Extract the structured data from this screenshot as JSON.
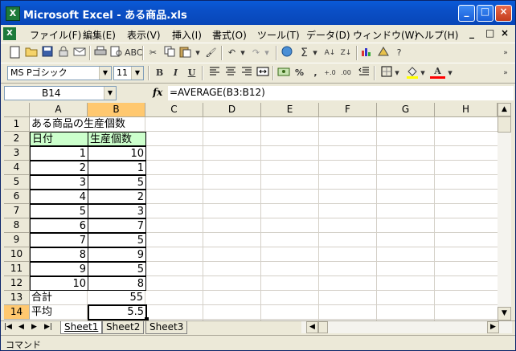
{
  "window": {
    "title": "Microsoft Excel - ある商品.xls",
    "app_icon": "excel-icon",
    "controls": {
      "minimize": "_",
      "maximize": "□",
      "close": "×"
    }
  },
  "menu": {
    "items": [
      "ファイル(F)",
      "編集(E)",
      "表示(V)",
      "挿入(I)",
      "書式(O)",
      "ツール(T)",
      "データ(D)",
      "ウィンドウ(W)",
      "ヘルプ(H)"
    ],
    "mdi": [
      "_",
      "□",
      "×"
    ]
  },
  "toolbar_standard": {
    "icons": [
      "new-icon",
      "open-icon",
      "save-icon",
      "permission-icon",
      "email-icon",
      "print-icon",
      "print-preview-icon",
      "spelling-icon",
      "cut-icon",
      "copy-icon",
      "paste-icon",
      "format-painter-icon",
      "undo-icon",
      "redo-icon",
      "hyperlink-icon",
      "autosum-icon",
      "sort-ascending-icon",
      "sort-descending-icon",
      "chart-wizard-icon",
      "drawing-icon",
      "help-icon"
    ],
    "glyphs": {
      "autosum": "Σ",
      "sort_asc": "A↓",
      "sort_desc": "Z↓"
    }
  },
  "toolbar_formatting": {
    "font_name": "MS Pゴシック",
    "font_size": "11",
    "bold": "B",
    "italic": "I",
    "underline": "U",
    "percent": "%",
    "comma": ",",
    "increase_decimal": "+.0",
    "decrease_decimal": ".00",
    "font_color_glyph": "A"
  },
  "formula_bar": {
    "name_box": "B14",
    "fx": "fx",
    "formula": "=AVERAGE(B3:B12)"
  },
  "columns": [
    "A",
    "B",
    "C",
    "D",
    "E",
    "F",
    "G",
    "H"
  ],
  "rows": [
    "1",
    "2",
    "3",
    "4",
    "5",
    "6",
    "7",
    "8",
    "9",
    "10",
    "11",
    "12",
    "13",
    "14"
  ],
  "sheet": {
    "title": "ある商品の生産個数",
    "header_date": "日付",
    "header_qty": "生産個数",
    "dates": [
      "1",
      "2",
      "3",
      "4",
      "5",
      "6",
      "7",
      "8",
      "9",
      "10"
    ],
    "quantities": [
      "10",
      "1",
      "5",
      "2",
      "3",
      "7",
      "5",
      "9",
      "5",
      "8"
    ],
    "total_label": "合計",
    "total_value": "55",
    "avg_label": "平均",
    "avg_value": "5.5"
  },
  "tabs": [
    "Sheet1",
    "Sheet2",
    "Sheet3"
  ],
  "tab_nav": [
    "|◀",
    "◀",
    "▶",
    "▶|"
  ],
  "status": "コマンド",
  "colors": {
    "title_bar": "#0a5bd8",
    "selection_header": "#ffc86f",
    "green_cell": "#ccffcc"
  }
}
